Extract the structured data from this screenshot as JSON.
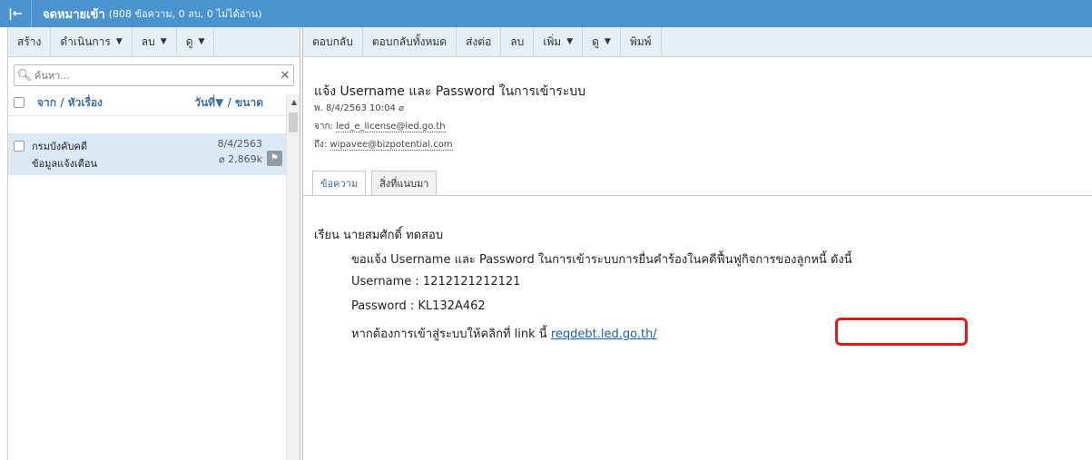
{
  "topbar": {
    "back_icon": "|←",
    "folder_title": "จดหมายเข้า",
    "folder_counts": "(808 ข้อความ, 0 ลบ, 0 ไม่ได้อ่าน)"
  },
  "left_toolbar": {
    "items": [
      "สร้าง",
      "ดำเนินการ",
      "ลบ",
      "ดู"
    ]
  },
  "search": {
    "placeholder": "ค้นหา..."
  },
  "list_header": {
    "from_subject": "จาก / หัวเรื่อง",
    "date_size": "วันที่▼ / ขนาด"
  },
  "messages": [
    {
      "sender": "กรมบังคับคดี",
      "subject": "ข้อมูลแจ้งเตือน",
      "date": "8/4/2563",
      "size": "2,869k"
    }
  ],
  "right_toolbar": {
    "items": [
      "ตอบกลับ",
      "ตอบกลับทั้งหมด",
      "ส่งต่อ",
      "ลบ",
      "เพิ่ม",
      "ดู",
      "พิมพ์"
    ]
  },
  "message": {
    "title": "แจ้ง Username และ Password ในการเข้าระบบ",
    "date": "พ. 8/4/2563 10:04",
    "from_label": "จาก:",
    "from": "led_e_license@led.go.th",
    "to_label": "ถึง:",
    "to": "wipavee@bizpotential.com",
    "tabs": [
      "ข้อความ",
      "สิ่งที่แนบมา"
    ],
    "greeting": "เรียน นายสมศักดิ์ ทดสอบ",
    "line1": "ขอแจ้ง Username และ Password ในการเข้าระบบการยื่นคำร้องในคดีฟื้นฟูกิจการของลูกหนี้ ดังนี้",
    "line2": "Username : 1212121212121",
    "line3": "Password : KL132A462",
    "line4_prefix": "หากต้องการเข้าสู่ระบบให้คลิกที่ link นี้",
    "link": "reqdebt.led.go.th/"
  },
  "colors": {
    "topbar": "#4a93cf",
    "toolbar": "#e6eef6",
    "selected_row": "#dbe8f5",
    "link": "#1a5fb4",
    "highlight": "#e11a1a"
  }
}
